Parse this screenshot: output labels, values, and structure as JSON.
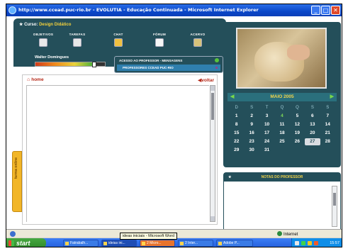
{
  "window": {
    "title": "http://www.ccead.puc-rio.br - EVOLUTIA - Educação Continuada - Microsoft Internet Explorer",
    "min": "_",
    "max": "□",
    "close": "✕"
  },
  "header": {
    "curso_label": "Curso:",
    "curso_name": "Design Didático",
    "bullet": "★",
    "nav": [
      {
        "label": "OBJETIVOS"
      },
      {
        "label": "TAREFAS"
      },
      {
        "label": "CHAT"
      },
      {
        "label": "FÓRUM"
      },
      {
        "label": "ACERVO"
      }
    ],
    "user_name": "Walter Domingues",
    "progress_fraction": 0.85
  },
  "message_panel": {
    "title": "ACESSO AO PROFESSOR - MENSAGENS",
    "row": "PROFESSORES CCEAD PUC-RIO",
    "row_close": "X"
  },
  "content": {
    "home": "home",
    "back": "voltar",
    "side_tab": "turma online"
  },
  "calendar": {
    "month": "MAIO 2005",
    "prev": "◀",
    "next": "▶",
    "weekdays": [
      "D",
      "S",
      "T",
      "Q",
      "Q",
      "S",
      "S"
    ],
    "days": [
      "1",
      "2",
      "3",
      "4",
      "5",
      "6",
      "7",
      "8",
      "9",
      "10",
      "11",
      "12",
      "13",
      "14",
      "15",
      "16",
      "17",
      "18",
      "19",
      "20",
      "21",
      "22",
      "23",
      "24",
      "25",
      "26",
      "27",
      "28",
      "29",
      "30",
      "31"
    ],
    "highlighted_day": "27"
  },
  "notes": {
    "title": "NOTAS DO PROFESSOR",
    "star": "★"
  },
  "statusbar": {
    "zone": "Internet",
    "tooltip": "ideas iniciais - Microsoft Word"
  },
  "taskbar": {
    "start": "start",
    "tasks": [
      {
        "label": "Fatrabalh..."
      },
      {
        "label": "ideias ini..."
      },
      {
        "label": "2 Micro..."
      },
      {
        "label": "2 Inter..."
      },
      {
        "label": "Adobe P..."
      }
    ],
    "clock": "15:57"
  }
}
